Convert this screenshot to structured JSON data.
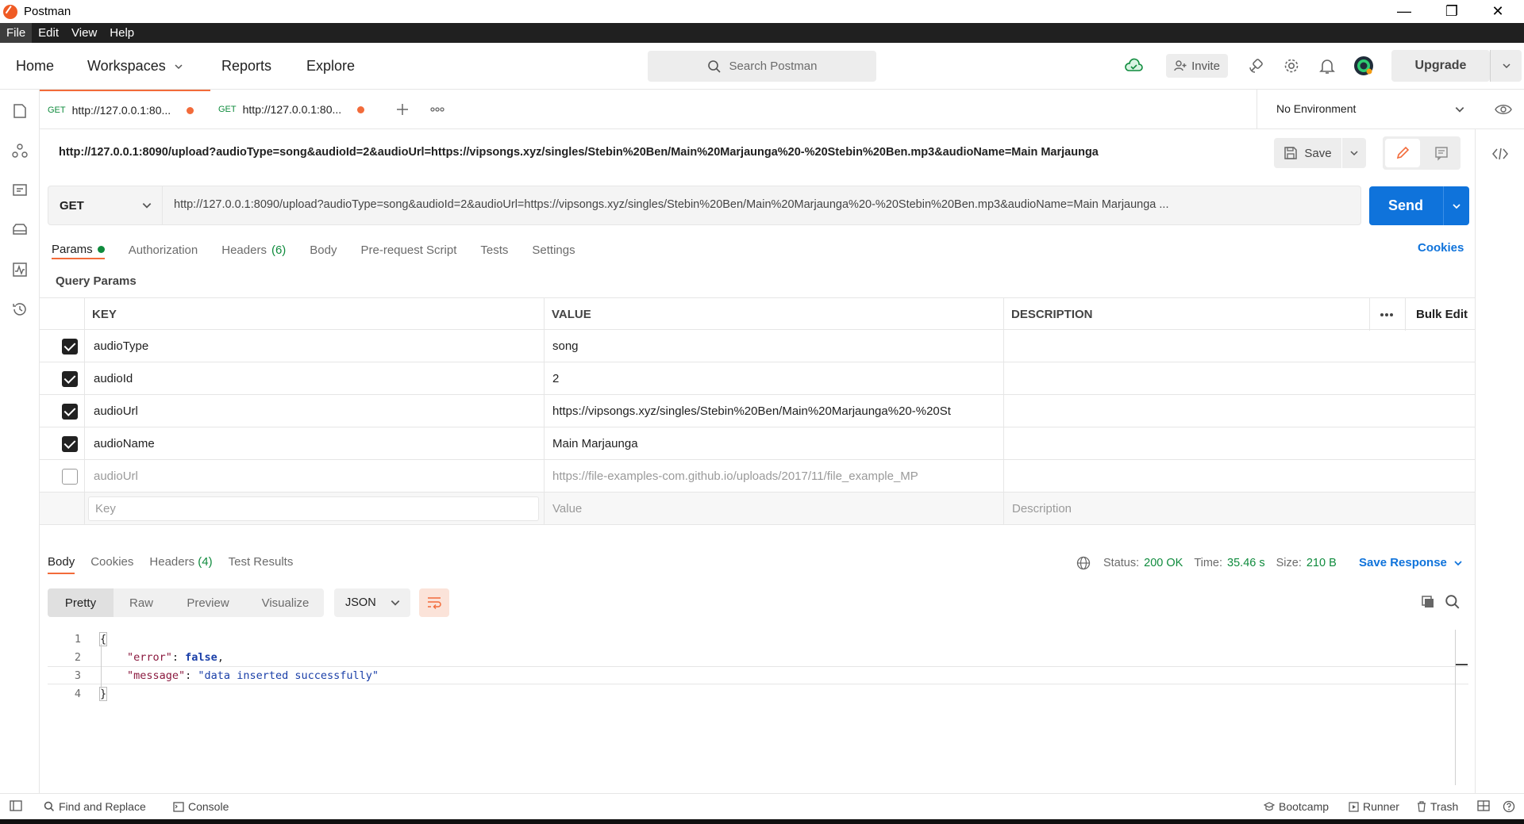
{
  "window": {
    "title": "Postman"
  },
  "menu": [
    "File",
    "Edit",
    "View",
    "Help"
  ],
  "header": {
    "nav": [
      "Home",
      "Workspaces",
      "Reports",
      "Explore"
    ],
    "search_placeholder": "Search Postman",
    "invite_label": "Invite",
    "upgrade_label": "Upgrade"
  },
  "tabs": [
    {
      "method": "GET",
      "label": "http://127.0.0.1:80..."
    },
    {
      "method": "GET",
      "label": "http://127.0.0.1:80..."
    }
  ],
  "environment": "No Environment",
  "request": {
    "title": "http://127.0.0.1:8090/upload?audioType=song&audioId=2&audioUrl=https://vipsongs.xyz/singles/Stebin%20Ben/Main%20Marjaunga%20-%20Stebin%20Ben.mp3&audioName=Main Marjaunga",
    "save_label": "Save",
    "method": "GET",
    "url": "http://127.0.0.1:8090/upload?audioType=song&audioId=2&audioUrl=https://vipsongs.xyz/singles/Stebin%20Ben/Main%20Marjaunga%20-%20Stebin%20Ben.mp3&audioName=Main Marjaunga ...",
    "send_label": "Send"
  },
  "request_tabs": {
    "params": "Params",
    "authorization": "Authorization",
    "headers": "Headers",
    "headers_count": "(6)",
    "body": "Body",
    "prerequest": "Pre-request Script",
    "tests": "Tests",
    "settings": "Settings",
    "cookies": "Cookies"
  },
  "params": {
    "section_label": "Query Params",
    "columns": {
      "key": "KEY",
      "value": "VALUE",
      "description": "DESCRIPTION",
      "bulk_edit": "Bulk Edit"
    },
    "rows": [
      {
        "key": "audioType",
        "value": "song",
        "checked": true
      },
      {
        "key": "audioId",
        "value": "2",
        "checked": true
      },
      {
        "key": "audioUrl",
        "value": "https://vipsongs.xyz/singles/Stebin%20Ben/Main%20Marjaunga%20-%20St",
        "checked": true
      },
      {
        "key": "audioName",
        "value": "Main Marjaunga",
        "checked": true
      },
      {
        "key": "audioUrl",
        "value": "https://file-examples-com.github.io/uploads/2017/11/file_example_MP",
        "checked": false
      }
    ],
    "new_row": {
      "key": "Key",
      "value": "Value",
      "description": "Description"
    }
  },
  "response": {
    "tabs": {
      "body": "Body",
      "cookies": "Cookies",
      "headers": "Headers",
      "headers_count": "(4)",
      "tests": "Test Results"
    },
    "status_label": "Status:",
    "status_value": "200 OK",
    "time_label": "Time:",
    "time_value": "35.46 s",
    "size_label": "Size:",
    "size_value": "210 B",
    "save_response": "Save Response",
    "formats": [
      "Pretty",
      "Raw",
      "Preview",
      "Visualize"
    ],
    "language": "JSON",
    "lines": [
      "1",
      "2",
      "3",
      "4"
    ],
    "code": {
      "open": "{",
      "error_key": "\"error\"",
      "error_val": "false",
      "message_key": "\"message\"",
      "message_val": "\"data inserted successfully\"",
      "close": "}"
    }
  },
  "statusbar": {
    "find_replace": "Find and Replace",
    "console": "Console",
    "bootcamp": "Bootcamp",
    "runner": "Runner",
    "trash": "Trash"
  },
  "colors": {
    "accent": "#f26b3a",
    "primary": "#0f73db",
    "success": "#0f8b3d"
  }
}
